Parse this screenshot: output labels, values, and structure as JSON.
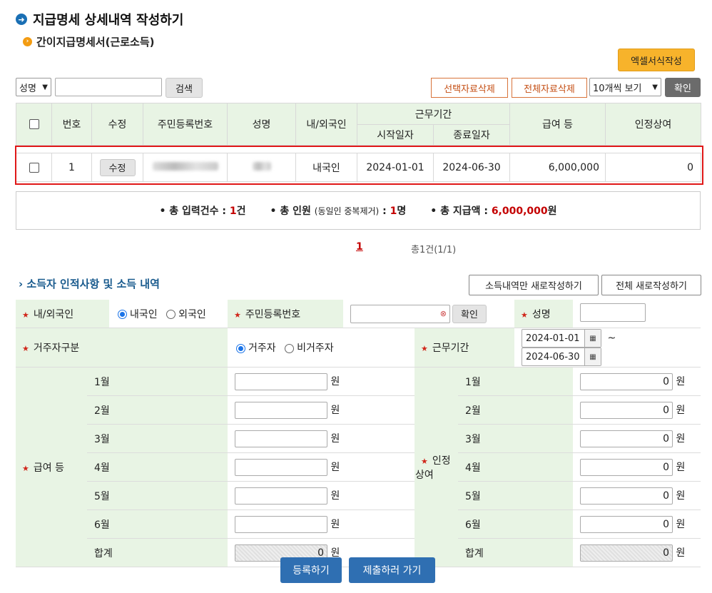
{
  "header": {
    "title": "지급명세 상세내역 작성하기",
    "subtitle": "간이지급명세서(근로소득)",
    "excel_button": "엑셀서식작성"
  },
  "search": {
    "field_option": "성명",
    "search_button": "검색",
    "delete_selected": "선택자료삭제",
    "delete_all": "전체자료삭제",
    "page_size": "10개씩 보기",
    "confirm_button": "확인"
  },
  "table": {
    "headers": {
      "no": "번호",
      "edit": "수정",
      "resident_no": "주민등록번호",
      "name": "성명",
      "nationality": "내/외국인",
      "work_period": "근무기간",
      "start_date": "시작일자",
      "end_date": "종료일자",
      "salary": "급여 등",
      "approved_bonus": "인정상여"
    },
    "rows": [
      {
        "no": "1",
        "edit": "수정",
        "nationality": "내국인",
        "start_date": "2024-01-01",
        "end_date": "2024-06-30",
        "salary": "6,000,000",
        "approved_bonus": "0"
      }
    ]
  },
  "summary": {
    "total_input_label": "총 입력건수 :",
    "total_input_value": "1",
    "total_input_unit": "건",
    "total_people_label": "총 인원",
    "total_people_note": "(동일인 중복제거)",
    "total_people_value": "1",
    "total_people_unit": "명",
    "total_pay_label": "총 지급액 :",
    "total_pay_value": "6,000,000",
    "total_pay_unit": "원"
  },
  "pagination": {
    "current": "1",
    "total": "총1건(1/1)"
  },
  "form": {
    "section_title": "소득자 인적사항 및 소득 내역",
    "new_income_button": "소득내역만 새로작성하기",
    "new_all_button": "전체 새로작성하기",
    "nationality_label": "내/외국인",
    "domestic": "내국인",
    "foreign": "외국인",
    "resident_label": "주민등록번호",
    "resident_confirm": "확인",
    "name_label": "성명",
    "residency_label": "거주자구분",
    "resident": "거주자",
    "nonresident": "비거주자",
    "period_label": "근무기간",
    "period_start": "2024-01-01",
    "period_sep": "~",
    "period_end": "2024-06-30",
    "salary_label": "급여 등",
    "bonus_label": "인정상여",
    "months": [
      "1월",
      "2월",
      "3월",
      "4월",
      "5월",
      "6월"
    ],
    "total_label": "합계",
    "unit": "원",
    "salary_values": [
      "",
      "",
      "",
      "",
      "",
      ""
    ],
    "salary_total": "0",
    "bonus_values": [
      "0",
      "0",
      "0",
      "0",
      "0",
      "0"
    ],
    "bonus_total": "0"
  },
  "footer": {
    "register_button": "등록하기",
    "submit_button": "제출하러 가기"
  },
  "colors": {
    "header_bg": "#e8f4e4",
    "accent_red": "#c40000",
    "highlight_border": "#e01818",
    "primary_blue": "#2f6fb2",
    "excel_orange": "#f7b32b"
  }
}
